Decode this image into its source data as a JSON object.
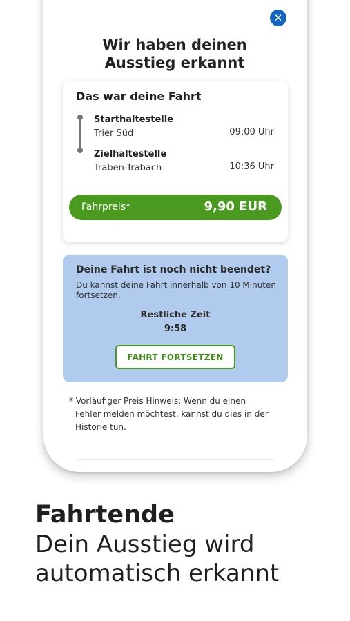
{
  "close": {
    "icon": "close-icon",
    "glyph": "✕"
  },
  "headline": {
    "line1": "Wir haben deinen",
    "line2": "Ausstieg erkannt"
  },
  "ride": {
    "title": "Das war deine Fahrt",
    "start": {
      "label": "Starthaltestelle",
      "name": "Trier Süd",
      "time": "09:00 Uhr"
    },
    "end": {
      "label": "Zielhaltestelle",
      "name": "Traben-Trabach",
      "time": "10:36 Uhr"
    },
    "price_label": "Fahrpreis*",
    "price_value": "9,90 EUR"
  },
  "continue_info": {
    "title": "Deine Fahrt ist noch nicht beendet?",
    "text": "Du kannst deine Fahrt innerhalb von 10 Minuten fortsetzen.",
    "remaining_label": "Restliche Zeit",
    "remaining_value": "9:58",
    "button_label": "FAHRT FORTSETZEN"
  },
  "footnote": {
    "line1": "* Vorläufiger Preis Hinweis: Wenn du einen",
    "line2": "Fehler melden möchtest, kannst du dies in der",
    "line3": "Historie tun."
  },
  "marketing": {
    "title": "Fahrtende",
    "line1": "Dein Ausstieg wird",
    "line2": "automatisch erkannt"
  },
  "colors": {
    "accent_green": "#4a9a1f",
    "info_blue": "#b0cbed",
    "close_blue": "#1565c0"
  }
}
